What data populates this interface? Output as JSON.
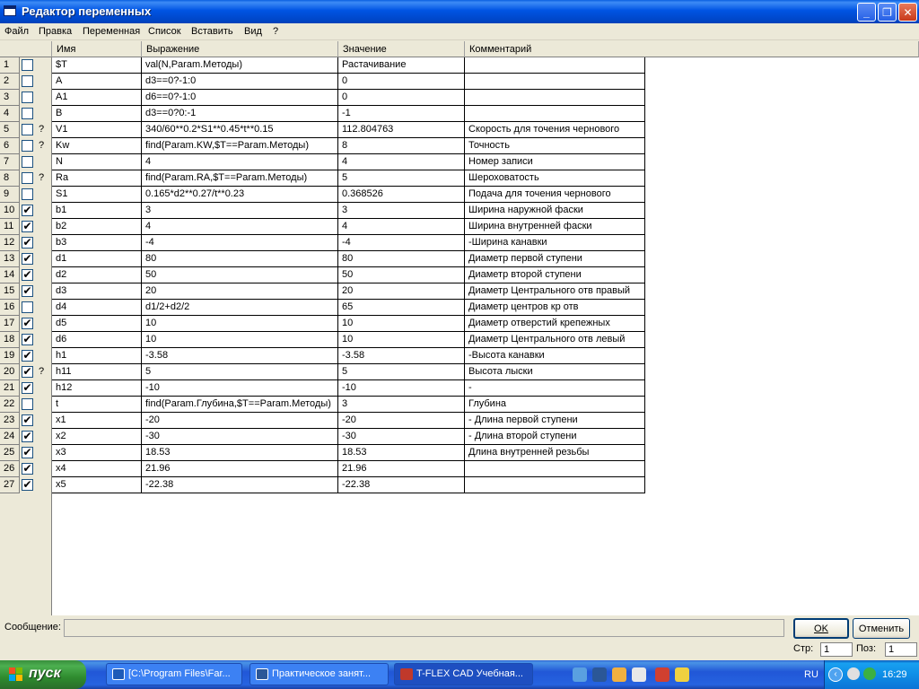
{
  "window": {
    "title": "Редактор переменных"
  },
  "menu": [
    "Файл",
    "Правка",
    "Переменная",
    "Список",
    "Вставить",
    "Вид",
    "?"
  ],
  "columns": [
    "Имя",
    "Выражение",
    "Значение",
    "Комментарий"
  ],
  "rows": [
    {
      "n": "1",
      "chk": false,
      "q": "",
      "name": "$T",
      "expr": "val(N,Param.Методы)",
      "value": "Растачивание",
      "comment": ""
    },
    {
      "n": "2",
      "chk": false,
      "q": "",
      "name": "A",
      "expr": "d3==0?-1:0",
      "value": "0",
      "comment": ""
    },
    {
      "n": "3",
      "chk": false,
      "q": "",
      "name": "A1",
      "expr": "d6==0?-1:0",
      "value": "0",
      "comment": ""
    },
    {
      "n": "4",
      "chk": false,
      "q": "",
      "name": "B",
      "expr": "d3==0?0:-1",
      "value": "-1",
      "comment": ""
    },
    {
      "n": "5",
      "chk": false,
      "q": "?",
      "name": "V1",
      "expr": "340/60**0.2*S1**0.45*t**0.15",
      "value": "112.804763",
      "comment": "Скорость для точения чернового"
    },
    {
      "n": "6",
      "chk": false,
      "q": "?",
      "name": "Kw",
      "expr": "find(Param.KW,$T==Param.Методы)",
      "value": "8",
      "comment": "Точность"
    },
    {
      "n": "7",
      "chk": false,
      "q": "",
      "name": "N",
      "expr": "4",
      "value": "4",
      "comment": "Номер записи"
    },
    {
      "n": "8",
      "chk": false,
      "q": "?",
      "name": "Ra",
      "expr": "find(Param.RA,$T==Param.Методы)",
      "value": "5",
      "comment": "Шероховатость"
    },
    {
      "n": "9",
      "chk": false,
      "q": "",
      "name": "S1",
      "expr": "0.165*d2**0.27/t**0.23",
      "value": "0.368526",
      "comment": "Подача для точения чернового"
    },
    {
      "n": "10",
      "chk": true,
      "q": "",
      "name": "b1",
      "expr": "3",
      "value": "3",
      "comment": "Ширина наружной фаски"
    },
    {
      "n": "11",
      "chk": true,
      "q": "",
      "name": "b2",
      "expr": "4",
      "value": "4",
      "comment": "Ширина внутренней фаски"
    },
    {
      "n": "12",
      "chk": true,
      "q": "",
      "name": "b3",
      "expr": "-4",
      "value": "-4",
      "comment": "-Ширина канавки"
    },
    {
      "n": "13",
      "chk": true,
      "q": "",
      "name": "d1",
      "expr": "80",
      "value": "80",
      "comment": "Диаметр первой ступени"
    },
    {
      "n": "14",
      "chk": true,
      "q": "",
      "name": "d2",
      "expr": "50",
      "value": "50",
      "comment": "Диаметр второй ступени"
    },
    {
      "n": "15",
      "chk": true,
      "q": "",
      "name": "d3",
      "expr": "20",
      "value": "20",
      "comment": "Диаметр Центрального отв правый"
    },
    {
      "n": "16",
      "chk": false,
      "q": "",
      "name": "d4",
      "expr": "d1/2+d2/2",
      "value": "65",
      "comment": "Диаметр центров кр отв"
    },
    {
      "n": "17",
      "chk": true,
      "q": "",
      "name": "d5",
      "expr": "10",
      "value": "10",
      "comment": "Диаметр отверстий крепежных"
    },
    {
      "n": "18",
      "chk": true,
      "q": "",
      "name": "d6",
      "expr": "10",
      "value": "10",
      "comment": "Диаметр Центрального отв левый"
    },
    {
      "n": "19",
      "chk": true,
      "q": "",
      "name": "h1",
      "expr": "-3.58",
      "value": "-3.58",
      "comment": "-Высота канавки"
    },
    {
      "n": "20",
      "chk": true,
      "q": "?",
      "name": "h11",
      "expr": "5",
      "value": "5",
      "comment": "Высота лыски"
    },
    {
      "n": "21",
      "chk": true,
      "q": "",
      "name": "h12",
      "expr": "-10",
      "value": "-10",
      "comment": "-"
    },
    {
      "n": "22",
      "chk": false,
      "q": "",
      "name": "t",
      "expr": "find(Param.Глубина,$T==Param.Методы)",
      "value": "3",
      "comment": "Глубина"
    },
    {
      "n": "23",
      "chk": true,
      "q": "",
      "name": "x1",
      "expr": "-20",
      "value": "-20",
      "comment": "- Длина первой ступени"
    },
    {
      "n": "24",
      "chk": true,
      "q": "",
      "name": "x2",
      "expr": "-30",
      "value": "-30",
      "comment": "- Длина второй ступени"
    },
    {
      "n": "25",
      "chk": true,
      "q": "",
      "name": "x3",
      "expr": "18.53",
      "value": "18.53",
      "comment": "Длина внутренней резьбы"
    },
    {
      "n": "26",
      "chk": true,
      "q": "",
      "name": "x4",
      "expr": "21.96",
      "value": "21.96",
      "comment": ""
    },
    {
      "n": "27",
      "chk": true,
      "q": "",
      "name": "x5",
      "expr": "-22.38",
      "value": "-22.38",
      "comment": ""
    }
  ],
  "bottom": {
    "message_label": "Сообщение:",
    "message": "",
    "ok": "OK",
    "cancel": "Отменить",
    "row_label": "Стр:",
    "row_value": "1",
    "pos_label": "Поз:",
    "pos_value": "1"
  },
  "taskbar": {
    "start": "пуск",
    "tasks": [
      "[C:\\Program Files\\Far...",
      "Практическое занят...",
      "T-FLEX CAD Учебная..."
    ],
    "lang": "RU",
    "time": "16:29"
  }
}
